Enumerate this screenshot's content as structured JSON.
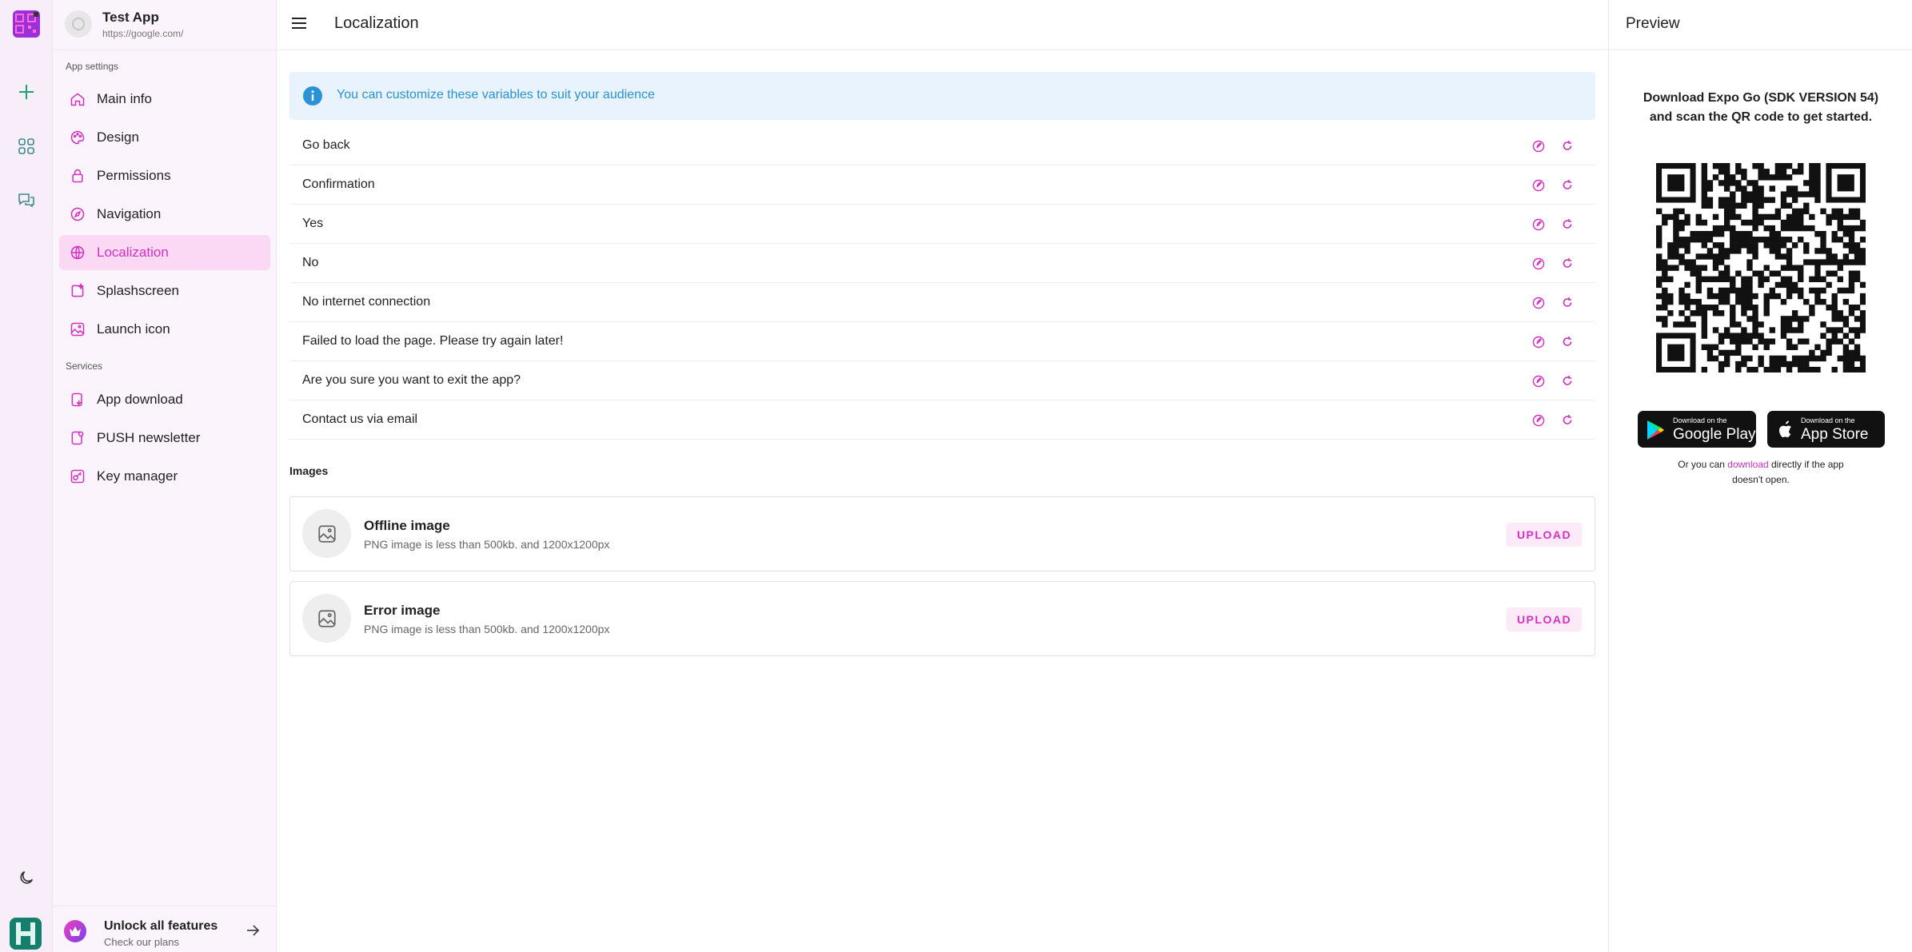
{
  "app": {
    "name": "Test App",
    "url": "https://google.com/"
  },
  "sidebar": {
    "app_settings_label": "App settings",
    "services_label": "Services",
    "items": [
      {
        "label": "Main info",
        "icon": "home-icon",
        "active": false
      },
      {
        "label": "Design",
        "icon": "palette-icon",
        "active": false
      },
      {
        "label": "Permissions",
        "icon": "lock-icon",
        "active": false
      },
      {
        "label": "Navigation",
        "icon": "compass-icon",
        "active": false
      },
      {
        "label": "Localization",
        "icon": "globe-icon",
        "active": true
      },
      {
        "label": "Splashscreen",
        "icon": "splash-icon",
        "active": false
      },
      {
        "label": "Launch icon",
        "icon": "image-icon",
        "active": false
      }
    ],
    "services": [
      {
        "label": "App download",
        "icon": "download-icon"
      },
      {
        "label": "PUSH newsletter",
        "icon": "newsletter-icon"
      },
      {
        "label": "Key manager",
        "icon": "key-icon"
      }
    ],
    "unlock": {
      "title": "Unlock all features",
      "subtitle": "Check our plans"
    }
  },
  "header": {
    "title": "Localization"
  },
  "info": {
    "text": "You can customize these variables to suit your audience"
  },
  "variables": [
    "Go back",
    "Confirmation",
    "Yes",
    "No",
    "No internet connection",
    "Failed to load the page. Please try again later!",
    "Are you sure you want to exit the app?",
    "Contact us via email"
  ],
  "images": {
    "heading": "Images",
    "items": [
      {
        "title": "Offline image",
        "desc": "PNG image is less than 500kb. and 1200x1200px",
        "button": "UPLOAD"
      },
      {
        "title": "Error image",
        "desc": "PNG image is less than 500kb. and 1200x1200px",
        "button": "UPLOAD"
      }
    ]
  },
  "preview": {
    "title": "Preview",
    "instructions_line1": "Download Expo Go (SDK VERSION 54)",
    "instructions_line2": "and scan the QR code to get started.",
    "google_play_small": "Download on the",
    "google_play_big": "Google Play",
    "app_store_small": "Download on the",
    "app_store_big": "App Store",
    "footer_before": "Or you can ",
    "footer_link": "download",
    "footer_after": " directly if the app doesn't open."
  },
  "colors": {
    "accent": "#d62fc0",
    "active_bg": "#fbd9f5",
    "info_bg": "#e8f3fd",
    "info_text": "#2a92d6"
  }
}
